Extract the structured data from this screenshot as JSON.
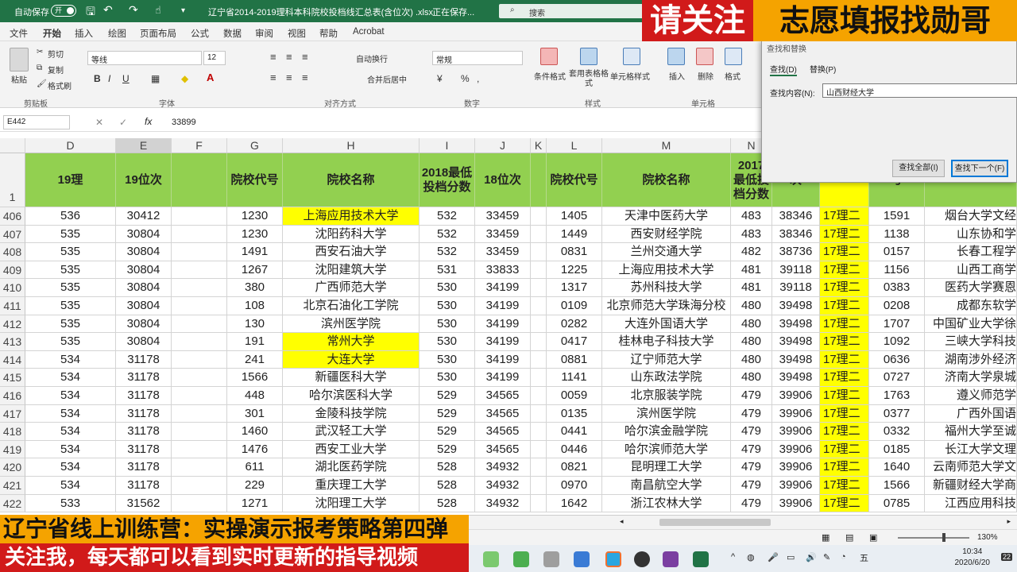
{
  "titlebar": {
    "autosave_label": "自动保存",
    "autosave_state": "开",
    "filename": "辽宁省2014-2019理科本科院校投档线汇总表(含位次) .xlsx",
    "save_status": "正在保存...",
    "search_placeholder": "搜索"
  },
  "menu": [
    "文件",
    "开始",
    "插入",
    "绘图",
    "页面布局",
    "公式",
    "数据",
    "审阅",
    "视图",
    "帮助",
    "Acrobat"
  ],
  "ribbon": {
    "cut": "剪切",
    "copy": "复制",
    "format_painter": "格式刷",
    "paste": "粘贴",
    "clipboard": "剪贴板",
    "font_name": "等线",
    "font_size": "12",
    "font_group": "字体",
    "wrap": "自动换行",
    "merge": "合并后居中",
    "align_group": "对齐方式",
    "number_format": "常规",
    "number_group": "数字",
    "cond_format": "条件格式",
    "table_format": "套用表格格式",
    "cell_style": "单元格样式",
    "style_group": "样式",
    "insert": "插入",
    "delete": "删除",
    "format": "格式",
    "cells_group": "单元格"
  },
  "formula": {
    "namebox": "E442",
    "value": "33899"
  },
  "columns": [
    "D",
    "E",
    "F",
    "G",
    "H",
    "I",
    "J",
    "K",
    "L",
    "M",
    "N"
  ],
  "header_row": {
    "row": "1",
    "D": "19理",
    "E": "19位次",
    "G": "院校代号",
    "H": "院校名称",
    "I": "2018最低投档分数",
    "J": "18位次",
    "L": "院校代号",
    "M": "院校名称",
    "N": "2017最低投档分数",
    "O": "次",
    "Q": "号",
    "R": "院校名称"
  },
  "rows": [
    {
      "r": "406",
      "D": "536",
      "E": "30412",
      "G": "1230",
      "H": "上海应用技术大学",
      "I": "532",
      "J": "33459",
      "L": "1405",
      "M": "天津中医药大学",
      "N": "483",
      "O": "38346",
      "P": "17理二",
      "Q": "1591",
      "R": "烟台大学文经",
      "hl": true
    },
    {
      "r": "407",
      "D": "535",
      "E": "30804",
      "G": "1230",
      "H": "沈阳药科大学",
      "I": "532",
      "J": "33459",
      "L": "1449",
      "M": "西安财经学院",
      "N": "483",
      "O": "38346",
      "P": "17理二",
      "Q": "1138",
      "R": "山东协和学"
    },
    {
      "r": "408",
      "D": "535",
      "E": "30804",
      "G": "1491",
      "H": "西安石油大学",
      "I": "532",
      "J": "33459",
      "L": "0831",
      "M": "兰州交通大学",
      "N": "482",
      "O": "38736",
      "P": "17理二",
      "Q": "0157",
      "R": "长春工程学"
    },
    {
      "r": "409",
      "D": "535",
      "E": "30804",
      "G": "1267",
      "H": "沈阳建筑大学",
      "I": "531",
      "J": "33833",
      "L": "1225",
      "M": "上海应用技术大学",
      "N": "481",
      "O": "39118",
      "P": "17理二",
      "Q": "1156",
      "R": "山西工商学"
    },
    {
      "r": "410",
      "D": "535",
      "E": "30804",
      "G": "380",
      "H": "广西师范大学",
      "I": "530",
      "J": "34199",
      "L": "1317",
      "M": "苏州科技大学",
      "N": "481",
      "O": "39118",
      "P": "17理二",
      "Q": "0383",
      "R": "医药大学赛恩"
    },
    {
      "r": "411",
      "D": "535",
      "E": "30804",
      "G": "108",
      "H": "北京石油化工学院",
      "I": "530",
      "J": "34199",
      "L": "0109",
      "M": "北京师范大学珠海分校",
      "N": "480",
      "O": "39498",
      "P": "17理二",
      "Q": "0208",
      "R": "成都东软学"
    },
    {
      "r": "412",
      "D": "535",
      "E": "30804",
      "G": "130",
      "H": "滨州医学院",
      "I": "530",
      "J": "34199",
      "L": "0282",
      "M": "大连外国语大学",
      "N": "480",
      "O": "39498",
      "P": "17理二",
      "Q": "1707",
      "R": "中国矿业大学徐"
    },
    {
      "r": "413",
      "D": "535",
      "E": "30804",
      "G": "191",
      "H": "常州大学",
      "I": "530",
      "J": "34199",
      "L": "0417",
      "M": "桂林电子科技大学",
      "N": "480",
      "O": "39498",
      "P": "17理二",
      "Q": "1092",
      "R": "三峡大学科技",
      "hl": true
    },
    {
      "r": "414",
      "D": "534",
      "E": "31178",
      "G": "241",
      "H": "大连大学",
      "I": "530",
      "J": "34199",
      "L": "0881",
      "M": "辽宁师范大学",
      "N": "480",
      "O": "39498",
      "P": "17理二",
      "Q": "0636",
      "R": "湖南涉外经济",
      "hl": true
    },
    {
      "r": "415",
      "D": "534",
      "E": "31178",
      "G": "1566",
      "H": "新疆医科大学",
      "I": "530",
      "J": "34199",
      "L": "1141",
      "M": "山东政法学院",
      "N": "480",
      "O": "39498",
      "P": "17理二",
      "Q": "0727",
      "R": "济南大学泉城"
    },
    {
      "r": "416",
      "D": "534",
      "E": "31178",
      "G": "448",
      "H": "哈尔滨医科大学",
      "I": "529",
      "J": "34565",
      "L": "0059",
      "M": "北京服装学院",
      "N": "479",
      "O": "39906",
      "P": "17理二",
      "Q": "1763",
      "R": "遵义师范学"
    },
    {
      "r": "417",
      "D": "534",
      "E": "31178",
      "G": "301",
      "H": "金陵科技学院",
      "I": "529",
      "J": "34565",
      "L": "0135",
      "M": "滨州医学院",
      "N": "479",
      "O": "39906",
      "P": "17理二",
      "Q": "0377",
      "R": "广西外国语"
    },
    {
      "r": "418",
      "D": "534",
      "E": "31178",
      "G": "1460",
      "H": "武汉轻工大学",
      "I": "529",
      "J": "34565",
      "L": "0441",
      "M": "哈尔滨金融学院",
      "N": "479",
      "O": "39906",
      "P": "17理二",
      "Q": "0332",
      "R": "福州大学至诚"
    },
    {
      "r": "419",
      "D": "534",
      "E": "31178",
      "G": "1476",
      "H": "西安工业大学",
      "I": "529",
      "J": "34565",
      "L": "0446",
      "M": "哈尔滨师范大学",
      "N": "479",
      "O": "39906",
      "P": "17理二",
      "Q": "0185",
      "R": "长江大学文理"
    },
    {
      "r": "420",
      "D": "534",
      "E": "31178",
      "G": "611",
      "H": "湖北医药学院",
      "I": "528",
      "J": "34932",
      "L": "0821",
      "M": "昆明理工大学",
      "N": "479",
      "O": "39906",
      "P": "17理二",
      "Q": "1640",
      "R": "云南师范大学文"
    },
    {
      "r": "421",
      "D": "534",
      "E": "31178",
      "G": "229",
      "H": "重庆理工大学",
      "I": "528",
      "J": "34932",
      "L": "0970",
      "M": "南昌航空大学",
      "N": "479",
      "O": "39906",
      "P": "17理二",
      "Q": "1566",
      "R": "新疆财经大学商"
    },
    {
      "r": "422",
      "D": "533",
      "E": "31562",
      "G": "1271",
      "H": "沈阳理工大学",
      "I": "528",
      "J": "34932",
      "L": "1642",
      "M": "浙江农林大学",
      "N": "479",
      "O": "39906",
      "P": "17理二",
      "Q": "0785",
      "R": "江西应用科技"
    }
  ],
  "dialog": {
    "title": "查找和替换",
    "tab_find": "查找(D)",
    "tab_replace": "替换(P)",
    "find_label": "查找内容(N):",
    "find_value": "山西财经大学",
    "btn_find_all": "查找全部(I)",
    "btn_find_next": "查找下一个(F)"
  },
  "banner": {
    "left": "请关注",
    "right": "志愿填报找勋哥"
  },
  "caption": {
    "line1": "辽宁省线上训练营：实操演示报考策略第四弹",
    "line2": "关注我，每天都可以看到实时更新的指导视频"
  },
  "status": {
    "zoom": "130%",
    "time": "10:34",
    "date": "2020/6/20",
    "ime": "五",
    "notify": "22"
  },
  "colors": {
    "excel_green": "#217346",
    "header_green": "#92d050",
    "highlight_yellow": "#ffff00",
    "banner_red": "#d11a1a",
    "banner_orange": "#f5a300"
  }
}
